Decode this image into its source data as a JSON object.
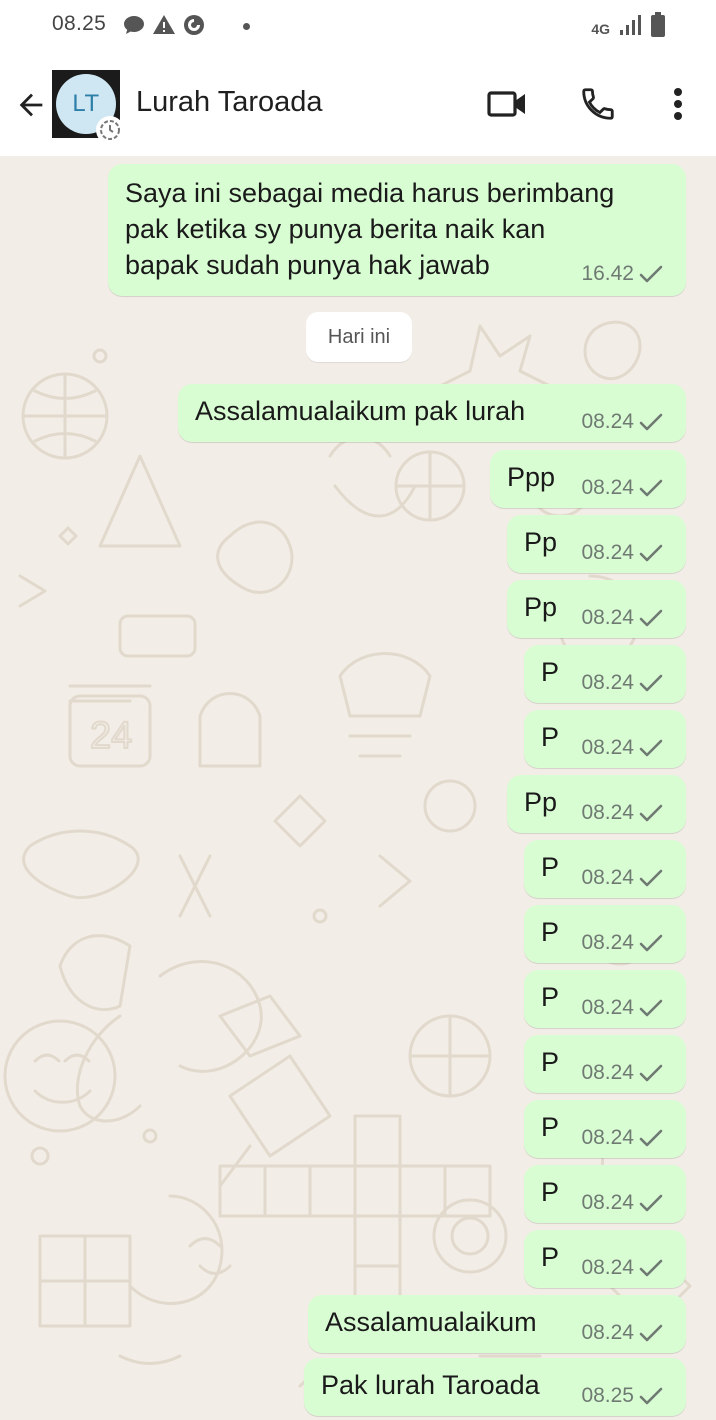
{
  "status_bar": {
    "time": "08.25",
    "network": "4G",
    "icons": [
      "chat-bubble-icon",
      "warning-icon",
      "data-saver-icon",
      "dot-icon",
      "signal-icon",
      "battery-icon"
    ]
  },
  "header": {
    "avatar_initials": "LT",
    "contact_name": "Lurah Taroada",
    "icons": [
      "back-arrow-icon",
      "video-call-icon",
      "phone-call-icon",
      "more-vert-icon"
    ]
  },
  "chat": {
    "date_separator": "Hari ini",
    "messages": [
      {
        "lines": [
          "Saya ini sebagai media harus berimbang",
          "pak ketika sy punya berita naik kan",
          "bapak sudah punya hak jawab"
        ],
        "time": "16.42",
        "status": "sent"
      },
      {
        "text": "Assalamualaikum pak lurah",
        "time": "08.24",
        "status": "sent"
      },
      {
        "text": "Ppp",
        "time": "08.24",
        "status": "sent"
      },
      {
        "text": "Pp",
        "time": "08.24",
        "status": "sent"
      },
      {
        "text": "Pp",
        "time": "08.24",
        "status": "sent"
      },
      {
        "text": "P",
        "time": "08.24",
        "status": "sent"
      },
      {
        "text": "P",
        "time": "08.24",
        "status": "sent"
      },
      {
        "text": "Pp",
        "time": "08.24",
        "status": "sent"
      },
      {
        "text": "P",
        "time": "08.24",
        "status": "sent"
      },
      {
        "text": "P",
        "time": "08.24",
        "status": "sent"
      },
      {
        "text": "P",
        "time": "08.24",
        "status": "sent"
      },
      {
        "text": "P",
        "time": "08.24",
        "status": "sent"
      },
      {
        "text": "P",
        "time": "08.24",
        "status": "sent"
      },
      {
        "text": "P",
        "time": "08.24",
        "status": "sent"
      },
      {
        "text": "P",
        "time": "08.24",
        "status": "sent"
      },
      {
        "text": "Assalamualaikum",
        "time": "08.24",
        "status": "sent"
      },
      {
        "text": "Pak lurah Taroada",
        "time": "08.25",
        "status": "sent"
      }
    ]
  },
  "colors": {
    "outgoing_bubble": "#d9fdd3",
    "chat_background": "#f2ede6",
    "avatar_bg": "#cfe7f3",
    "avatar_text": "#2d7fa8",
    "tick": "#6f7a73"
  }
}
